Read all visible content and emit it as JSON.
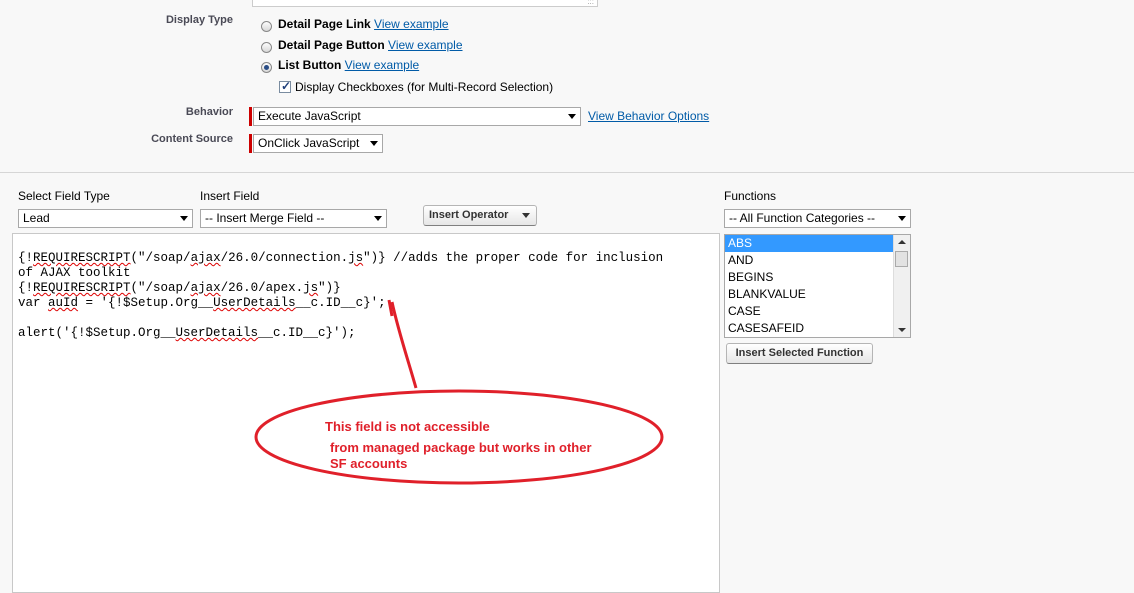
{
  "display_type": {
    "label": "Display Type",
    "options": [
      {
        "label": "Detail Page Link",
        "link": "View example",
        "selected": false
      },
      {
        "label": "Detail Page Button",
        "link": "View example",
        "selected": false
      },
      {
        "label": "List Button",
        "link": "View example",
        "selected": true
      }
    ],
    "checkbox_label": "Display Checkboxes (for Multi-Record Selection)",
    "checkbox_checked": true
  },
  "behavior": {
    "label": "Behavior",
    "value": "Execute JavaScript",
    "link": "View Behavior Options"
  },
  "content_source": {
    "label": "Content Source",
    "value": "OnClick JavaScript"
  },
  "editor": {
    "select_field_type": {
      "label": "Select Field Type",
      "value": "Lead"
    },
    "insert_field": {
      "label": "Insert Field",
      "value": "-- Insert Merge Field --"
    },
    "insert_operator_button": "Insert Operator",
    "functions": {
      "label": "Functions",
      "category": "-- All Function Categories --",
      "items": [
        "ABS",
        "AND",
        "BEGINS",
        "BLANKVALUE",
        "CASE",
        "CASESAFEID"
      ],
      "selected_index": 0,
      "insert_button": "Insert Selected Function"
    },
    "code": {
      "l1_a": "{!",
      "l1_b": "REQUIRESCRIPT",
      "l1_c": "(\"/soap/",
      "l1_d": "ajax",
      "l1_e": "/26.0/connection.",
      "l1_f": "js",
      "l1_g": "\")} //adds the proper code for inclusion",
      "l2": "of AJAX toolkit",
      "l3_a": "{!",
      "l3_b": "REQUIRESCRIPT",
      "l3_c": "(\"/soap/",
      "l3_d": "ajax",
      "l3_e": "/26.0/apex.",
      "l3_f": "js",
      "l3_g": "\")}",
      "l4_a": "var ",
      "l4_b": "auId",
      "l4_c": " = '{!$Setup.Org__",
      "l4_d": "UserDetails",
      "l4_e": "__c.ID__c}';",
      "l6_a": "alert('{!$Setup.Org__",
      "l6_b": "UserDetails",
      "l6_c": "__c.ID__c}');"
    }
  },
  "annotation": {
    "line1": "This field is not accessible",
    "line2": "from managed package but works in other",
    "line3": "SF accounts",
    "color": "#e0202a"
  }
}
